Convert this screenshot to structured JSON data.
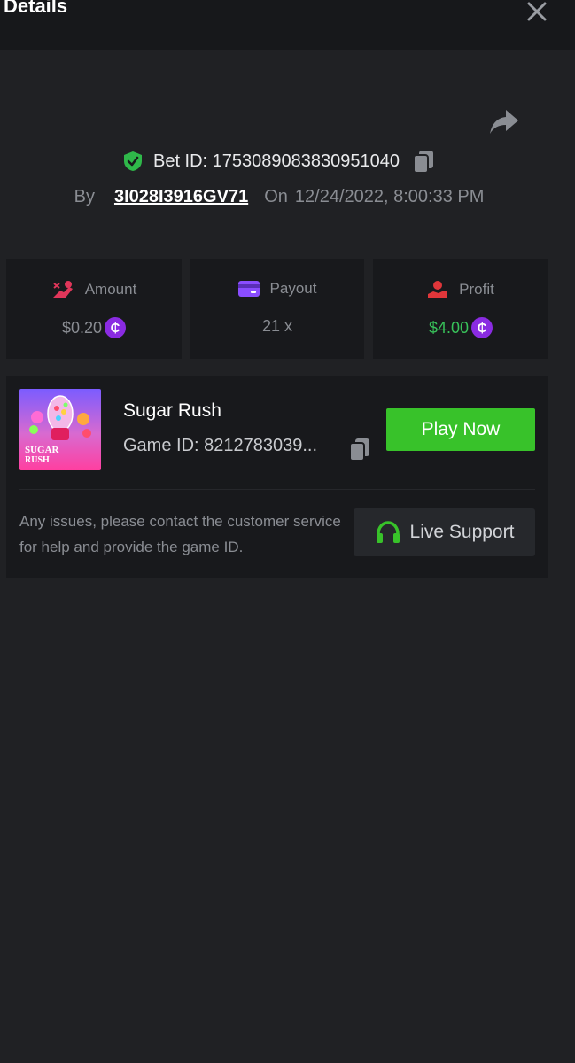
{
  "header": {
    "title": "Details"
  },
  "bet": {
    "id_label": "Bet ID: 1753089083830951040",
    "by_label": "By",
    "user": "3I028I3916GV71",
    "on_label": "On",
    "datetime": "12/24/2022, 8:00:33 PM"
  },
  "stats": {
    "amount": {
      "label": "Amount",
      "value": "$0.20",
      "icon": "bet-hand-icon"
    },
    "payout": {
      "label": "Payout",
      "value": "21 x",
      "icon": "card-icon"
    },
    "profit": {
      "label": "Profit",
      "value": "$4.00",
      "icon": "hand-coin-icon"
    },
    "coin_symbol": "₵"
  },
  "game": {
    "title": "Sugar Rush",
    "id_label": "Game ID: 8212783039...",
    "thumbnail_text": "SUGAR RUSH",
    "play_label": "Play Now"
  },
  "help": {
    "text": "Any issues, please contact the customer service for help and provide the game ID.",
    "support_label": "Live Support"
  },
  "colors": {
    "background": "#202124",
    "card": "#18191c",
    "accent_green": "#38c22a",
    "profit_green": "#38c25a",
    "coin_purple": "#8a2be2"
  }
}
